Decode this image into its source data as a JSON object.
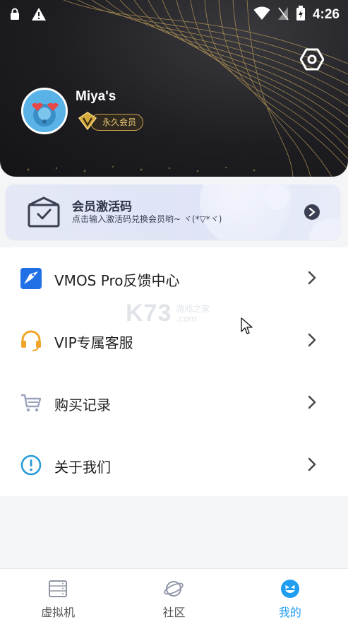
{
  "status_bar": {
    "time": "4:26"
  },
  "profile": {
    "username": "Miya's",
    "membership_badge": "永久会员"
  },
  "activation_card": {
    "title": "会员激活码",
    "subtitle": "点击输入激活码兑换会员哟~ ヾ(*▽*ヾ)"
  },
  "menu": {
    "items": [
      {
        "label": "VMOS Pro反馈中心",
        "icon": "vmos-feedback-icon"
      },
      {
        "label": "VIP专属客服",
        "icon": "headset-icon"
      },
      {
        "label": "购买记录",
        "icon": "cart-icon"
      },
      {
        "label": "关于我们",
        "icon": "info-icon"
      }
    ]
  },
  "watermark": {
    "logo": "K73",
    "line1": "游戏之家",
    "line2": ".com"
  },
  "tabbar": {
    "tabs": [
      {
        "label": "虚拟机",
        "icon": "virtual-machine-icon",
        "active": false
      },
      {
        "label": "社区",
        "icon": "planet-icon",
        "active": false
      },
      {
        "label": "我的",
        "icon": "smile-face-icon",
        "active": true
      }
    ]
  },
  "colors": {
    "accent": "#1f9df1",
    "header_dark": "#1e1e22",
    "gold": "#c8a24a"
  }
}
